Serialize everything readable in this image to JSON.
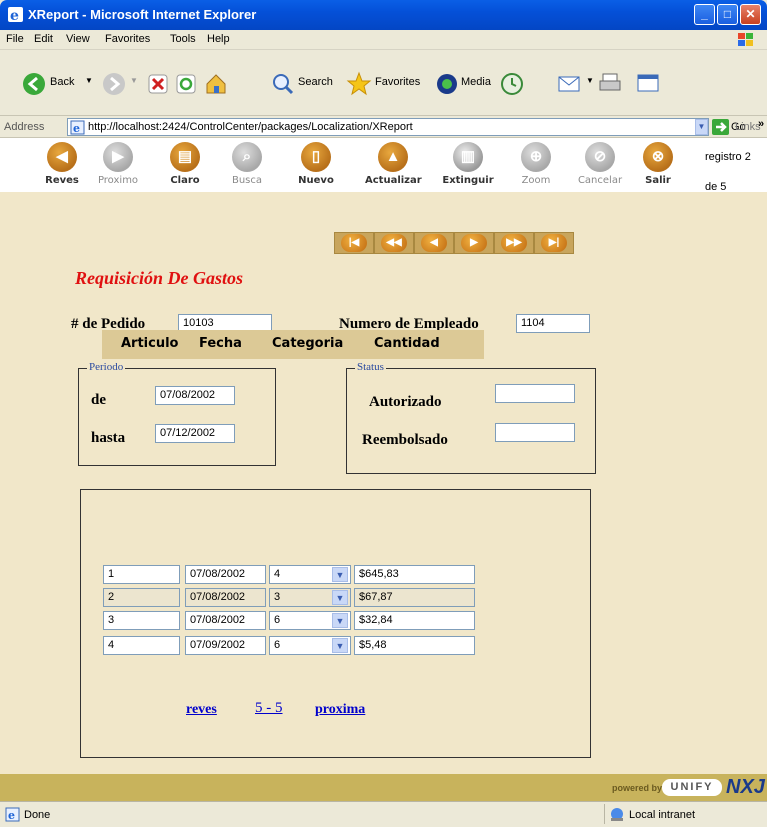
{
  "window": {
    "title": "XReport - Microsoft Internet Explorer"
  },
  "menu": [
    "File",
    "Edit",
    "View",
    "Favorites",
    "Tools",
    "Help"
  ],
  "toolbar": {
    "back": "Back",
    "search": "Search",
    "favorites": "Favorites",
    "media": "Media"
  },
  "address": {
    "label": "Address",
    "url": "http://localhost:2424/ControlCenter/packages/Localization/XReport",
    "go": "Go",
    "links": "Links"
  },
  "app_toolbar": {
    "buttons": [
      "Reves",
      "Proximo",
      "Claro",
      "Busca",
      "Nuevo",
      "Actualizar",
      "Extinguir",
      "Zoom",
      "Cancelar",
      "Salir"
    ],
    "record_line1": "registro 2",
    "record_line2": "de 5"
  },
  "form": {
    "title": "Requisición De Gastos",
    "pedido_label": "# de Pedido",
    "pedido_value": "10103",
    "empleado_label": "Numero de Empleado",
    "empleado_value": "1104",
    "periodo_legend": "Periodo",
    "de_label": "de",
    "de_value": "07/08/2002",
    "hasta_label": "hasta",
    "hasta_value": "07/12/2002",
    "status_legend": "Status",
    "autorizado_label": "Autorizado",
    "autorizado_value": "",
    "reembolsado_label": "Reembolsado",
    "reembolsado_value": ""
  },
  "grid": {
    "headers": [
      "Articulo",
      "Fecha",
      "Categoria",
      "Cantidad"
    ],
    "rows": [
      {
        "articulo": "1",
        "fecha": "07/08/2002",
        "categoria": "4",
        "cantidad": "$645,83"
      },
      {
        "articulo": "2",
        "fecha": "07/08/2002",
        "categoria": "3",
        "cantidad": "$67,87"
      },
      {
        "articulo": "3",
        "fecha": "07/08/2002",
        "categoria": "6",
        "cantidad": "$32,84"
      },
      {
        "articulo": "4",
        "fecha": "07/09/2002",
        "categoria": "6",
        "cantidad": "$5,48"
      }
    ],
    "pager": {
      "prev": "reves",
      "range": "5 - 5",
      "next": "proxima"
    }
  },
  "footer": {
    "powered_by": "powered by",
    "brand": "UNIFY",
    "brand2": "NXJ"
  },
  "status": {
    "left": "Done",
    "right": "Local intranet"
  }
}
